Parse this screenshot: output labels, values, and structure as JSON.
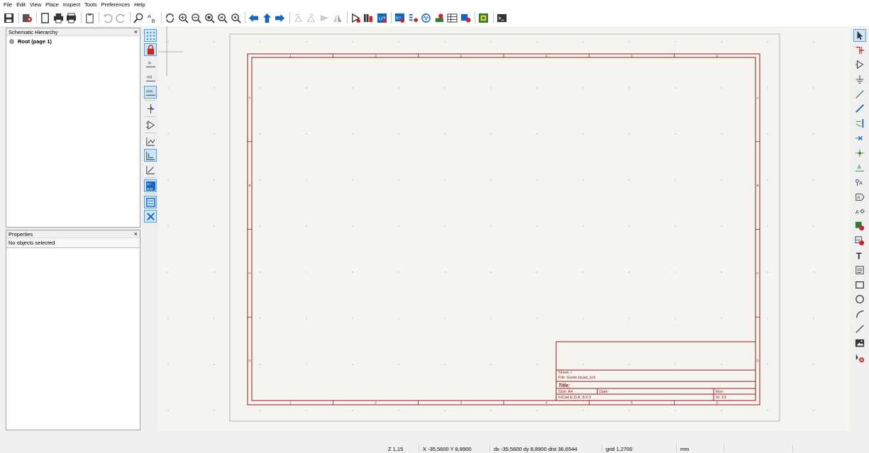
{
  "menu": [
    "File",
    "Edit",
    "View",
    "Place",
    "Inspect",
    "Tools",
    "Preferences",
    "Help"
  ],
  "hierarchy_panel": {
    "title": "Schematic Hierarchy",
    "close": "×",
    "root_item": "Root (page 1)"
  },
  "properties_panel": {
    "title": "Properties",
    "close": "×",
    "status": "No objects selected"
  },
  "sheet": {
    "col_labels_top": [
      "1",
      "2",
      "3",
      "4",
      "5",
      "6"
    ],
    "col_labels_bottom": [
      "1",
      "2",
      "3",
      "4",
      "5",
      "6"
    ],
    "row_labels_left": [
      "A",
      "B",
      "C",
      "D"
    ],
    "row_labels_right": [
      "A",
      "B",
      "C",
      "D"
    ],
    "title_block": {
      "sheet": "Sheet: /",
      "file": "File: Guide.kicad_sch",
      "title": "Title:",
      "size": "Size: A4",
      "date": "Date:",
      "rev": "Rev:",
      "kicad": "KiCad E.D.A. 8.0.3",
      "id": "Id: 1/1"
    }
  },
  "status": {
    "zoom": "Z 1,15",
    "xy": "X -35,5600  Y 8,8900",
    "delta": "dx -35,5600  dy 8,8900  dist 36,6544",
    "grid": "grid 1,2700",
    "units": "mm"
  },
  "colors": {
    "sheet_border": "#8b1a1a",
    "canvas_bg": "#f5f4ef",
    "active_tool": "#cde6f7"
  }
}
